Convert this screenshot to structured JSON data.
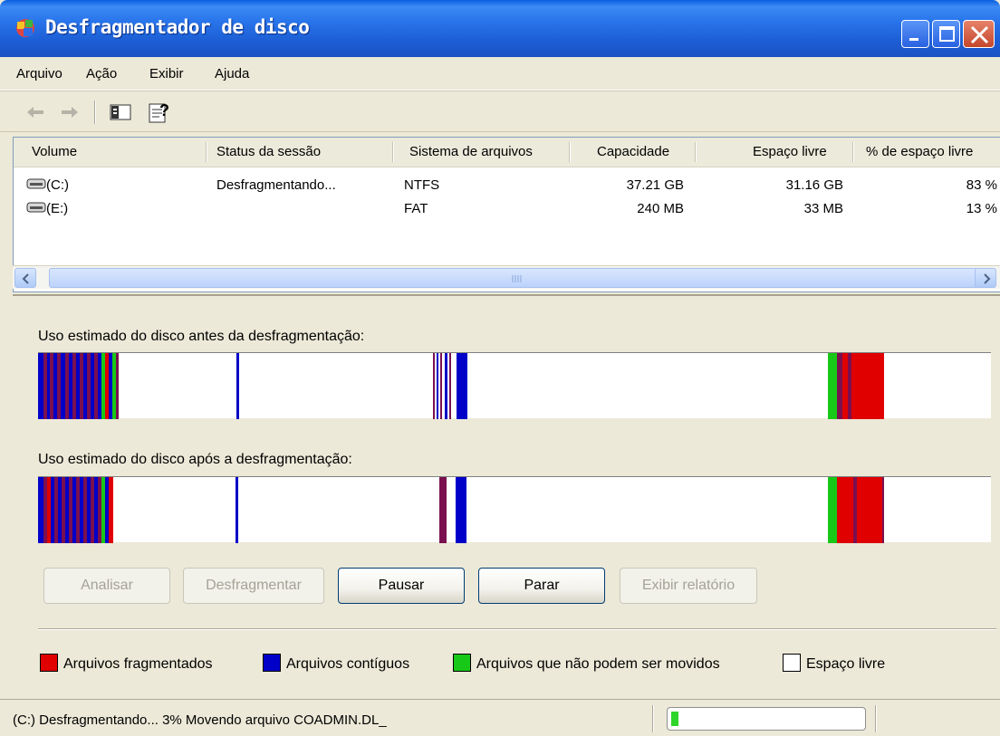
{
  "window": {
    "title": "Desfragmentador de disco",
    "controls": [
      "minimize",
      "maximize",
      "close"
    ]
  },
  "menu": [
    "Arquivo",
    "Ação",
    "Exibir",
    "Ajuda"
  ],
  "toolbar": {
    "icons": [
      "back-arrow-icon",
      "forward-arrow-icon",
      "show-hide-console-tree-icon",
      "help-icon"
    ]
  },
  "list": {
    "columns": [
      "Volume",
      "Status da sessão",
      "Sistema de arquivos",
      "Capacidade",
      "Espaço livre",
      "% de espaço livre"
    ],
    "rows": [
      {
        "volume": "(C:)",
        "status": "Desfragmentando...",
        "fs": "NTFS",
        "capacity": "37.21 GB",
        "free": "31.16 GB",
        "pct": "83 %"
      },
      {
        "volume": "(E:)",
        "status": "",
        "fs": "FAT",
        "capacity": "240 MB",
        "free": "33 MB",
        "pct": "13 %"
      }
    ]
  },
  "analysis": {
    "before_label": "Uso estimado do disco antes da desfragmentação:",
    "after_label": "Uso estimado do disco após a desfragmentação:"
  },
  "buttons": {
    "analyze": "Analisar",
    "defragment": "Desfragmentar",
    "pause": "Pausar",
    "stop": "Parar",
    "report": "Exibir relatório"
  },
  "legend": {
    "fragmented": "Arquivos fragmentados",
    "contiguous": "Arquivos contíguos",
    "unmovable": "Arquivos que não podem ser movidos",
    "free": "Espaço livre"
  },
  "colors": {
    "fragmented": "#e00000",
    "contiguous": "#0000c8",
    "unmovable": "#18c818",
    "free": "#ffffff"
  },
  "status": {
    "text": "(C:) Desfragmentando... 3%  Movendo arquivo COADMIN.DL_",
    "progress": 0.03
  }
}
